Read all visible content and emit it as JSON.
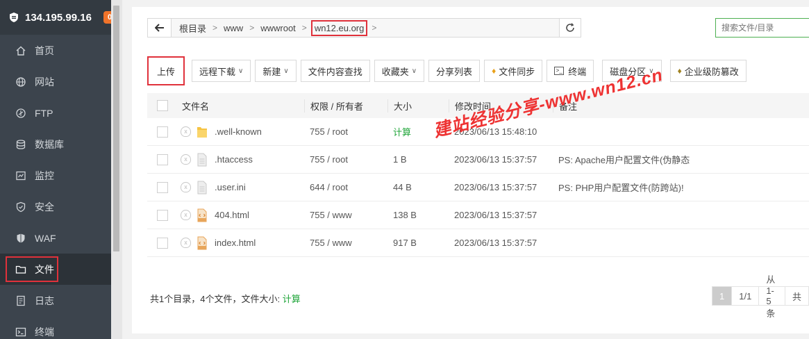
{
  "sidebar": {
    "ip": "134.195.99.16",
    "badge": "0",
    "items": [
      {
        "label": "首页",
        "icon": "home-icon"
      },
      {
        "label": "网站",
        "icon": "globe-icon"
      },
      {
        "label": "FTP",
        "icon": "ftp-icon"
      },
      {
        "label": "数据库",
        "icon": "database-icon"
      },
      {
        "label": "监控",
        "icon": "monitor-icon"
      },
      {
        "label": "安全",
        "icon": "shield-icon"
      },
      {
        "label": "WAF",
        "icon": "waf-shield-icon"
      },
      {
        "label": "文件",
        "icon": "folder-icon"
      },
      {
        "label": "日志",
        "icon": "log-icon"
      },
      {
        "label": "终端",
        "icon": "terminal-icon"
      }
    ]
  },
  "path": {
    "crumbs": [
      "根目录",
      "www",
      "wwwroot",
      "wn12.eu.org"
    ]
  },
  "search": {
    "placeholder": "搜索文件/目录"
  },
  "toolbar": {
    "upload": "上传",
    "remote_download": "远程下载",
    "new": "新建",
    "content_search": "文件内容查找",
    "favorites": "收藏夹",
    "share_list": "分享列表",
    "file_sync": "文件同步",
    "terminal": "终端",
    "disk_partition": "磁盘分区",
    "tamper_proof": "企业级防篡改"
  },
  "table": {
    "headers": {
      "name": "文件名",
      "perm": "权限 / 所有者",
      "size": "大小",
      "time": "修改时间",
      "note": "备注"
    },
    "rows": [
      {
        "name": ".well-known",
        "type": "folder",
        "perm": "755 / root",
        "size": "计算",
        "time": "2023/06/13 15:48:10",
        "note": ""
      },
      {
        "name": ".htaccess",
        "type": "file",
        "perm": "755 / root",
        "size": "1 B",
        "time": "2023/06/13 15:37:57",
        "note": "PS: Apache用户配置文件(伪静态"
      },
      {
        "name": ".user.ini",
        "type": "file",
        "perm": "644 / root",
        "size": "44 B",
        "time": "2023/06/13 15:37:57",
        "note": "PS: PHP用户配置文件(防跨站)!"
      },
      {
        "name": "404.html",
        "type": "html",
        "perm": "755 / www",
        "size": "138 B",
        "time": "2023/06/13 15:37:57",
        "note": ""
      },
      {
        "name": "index.html",
        "type": "html",
        "perm": "755 / www",
        "size": "917 B",
        "time": "2023/06/13 15:37:57",
        "note": ""
      }
    ]
  },
  "footer": {
    "summary": "共1个目录，4个文件，文件大小:",
    "calc": "计算"
  },
  "pager": {
    "current": "1",
    "pages": "1/1",
    "range": "从1-5条",
    "trail": "共"
  },
  "watermark": "建站经验分享-www.wn12.cn",
  "colors": {
    "accent": "#20a53a",
    "highlight": "#e0313b",
    "sidebar": "#3c444d",
    "badge": "#f0732a"
  }
}
